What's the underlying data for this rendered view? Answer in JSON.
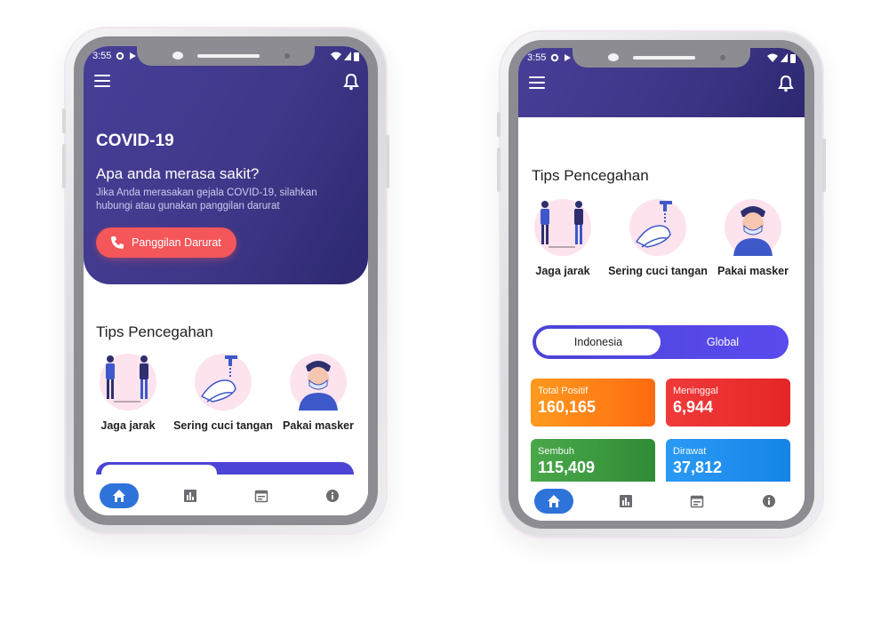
{
  "status_bar": {
    "time": "3:55"
  },
  "hero": {
    "title": "COVID-19",
    "question": "Apa anda merasa sakit?",
    "description": "Jika Anda merasakan gejala COVID-19, silahkan hubungi atau gunakan panggilan darurat",
    "emergency_button": "Panggilan Darurat"
  },
  "tips": {
    "title": "Tips Pencegahan",
    "items": [
      {
        "label": "Jaga jarak",
        "icon": "social-distance-icon"
      },
      {
        "label": "Sering cuci tangan",
        "icon": "wash-hands-icon"
      },
      {
        "label": "Pakai masker",
        "icon": "wear-mask-icon"
      }
    ]
  },
  "region_toggle": {
    "options": [
      "Indonesia",
      "Global"
    ],
    "selected": "Indonesia"
  },
  "stats": [
    {
      "label": "Total Positif",
      "value": "160,165",
      "color": "#ff7a12"
    },
    {
      "label": "Meninggal",
      "value": "6,944",
      "color": "#ee2f2f"
    },
    {
      "label": "Sembuh",
      "value": "115,409",
      "color": "#3b9b3e"
    },
    {
      "label": "Dirawat",
      "value": "37,812",
      "color": "#1e8ef0"
    }
  ],
  "bottom_nav": {
    "items": [
      "home-icon",
      "chart-icon",
      "calendar-icon",
      "info-icon"
    ],
    "active": "home-icon"
  },
  "colors": {
    "primary": "#473f97",
    "accent": "#f4565a",
    "toggle": "#4c44d6",
    "nav_active": "#2e73d9"
  }
}
